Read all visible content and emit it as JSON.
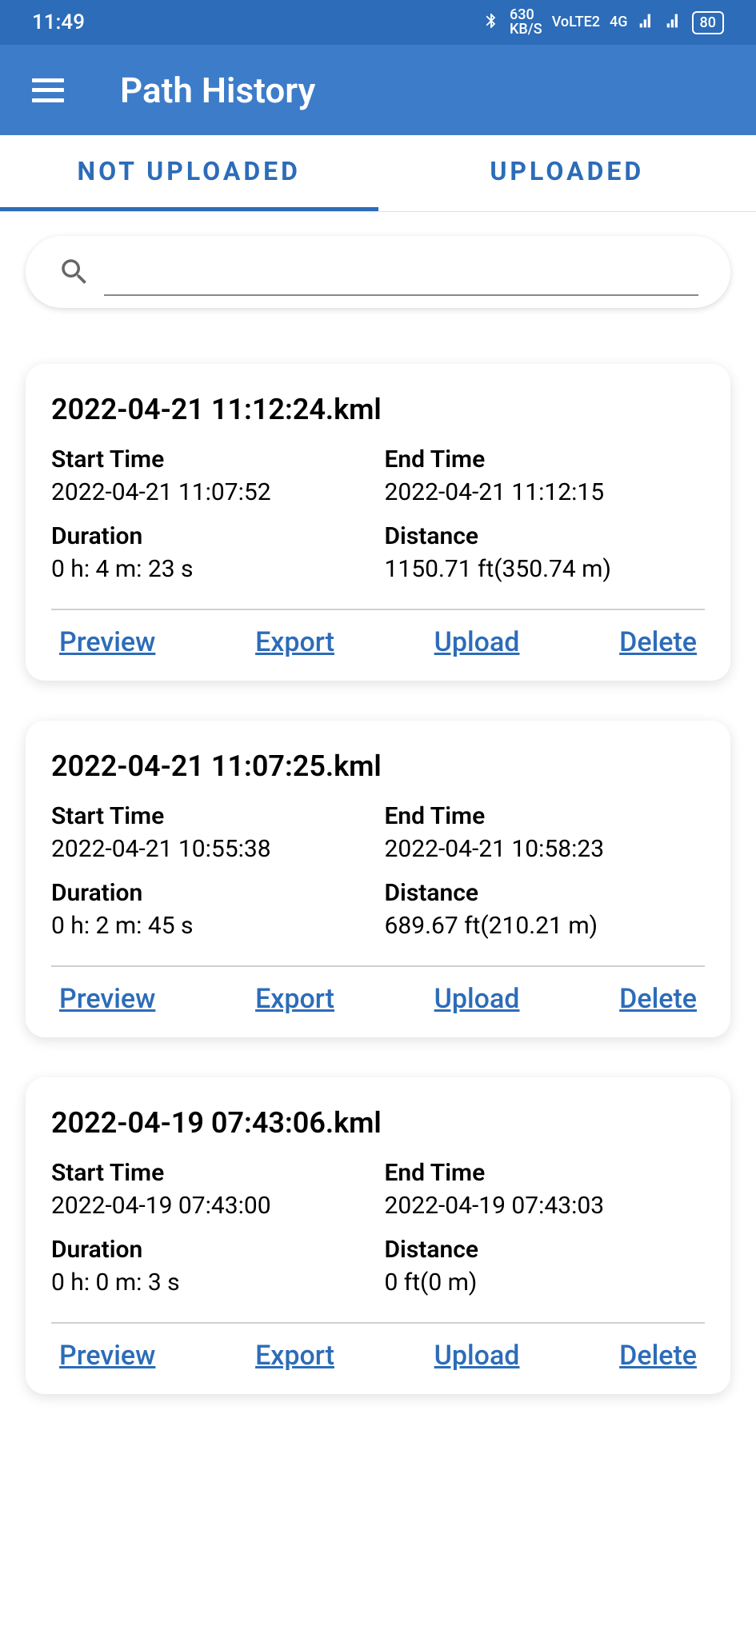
{
  "status_bar": {
    "time": "11:49",
    "network_speed": "630",
    "network_unit": "KB/S",
    "volte": "VoLTE2",
    "net_type": "4G",
    "battery": "80"
  },
  "header": {
    "title": "Path History"
  },
  "tabs": {
    "not_uploaded": "NOT UPLOADED",
    "uploaded": "UPLOADED",
    "active": "not_uploaded"
  },
  "search": {
    "placeholder": ""
  },
  "labels": {
    "start_time": "Start Time",
    "end_time": "End Time",
    "duration": "Duration",
    "distance": "Distance",
    "preview": "Preview",
    "export": "Export",
    "upload": "Upload",
    "delete": "Delete"
  },
  "items": [
    {
      "filename": "2022-04-21 11:12:24.kml",
      "start_time": "2022-04-21 11:07:52",
      "end_time": "2022-04-21 11:12:15",
      "duration": "0 h: 4 m: 23 s",
      "distance": "1150.71 ft(350.74 m)"
    },
    {
      "filename": "2022-04-21 11:07:25.kml",
      "start_time": "2022-04-21 10:55:38",
      "end_time": "2022-04-21 10:58:23",
      "duration": "0 h: 2 m: 45 s",
      "distance": "689.67 ft(210.21 m)"
    },
    {
      "filename": "2022-04-19 07:43:06.kml",
      "start_time": "2022-04-19 07:43:00",
      "end_time": "2022-04-19 07:43:03",
      "duration": "0 h: 0 m: 3 s",
      "distance": "0 ft(0 m)"
    }
  ]
}
